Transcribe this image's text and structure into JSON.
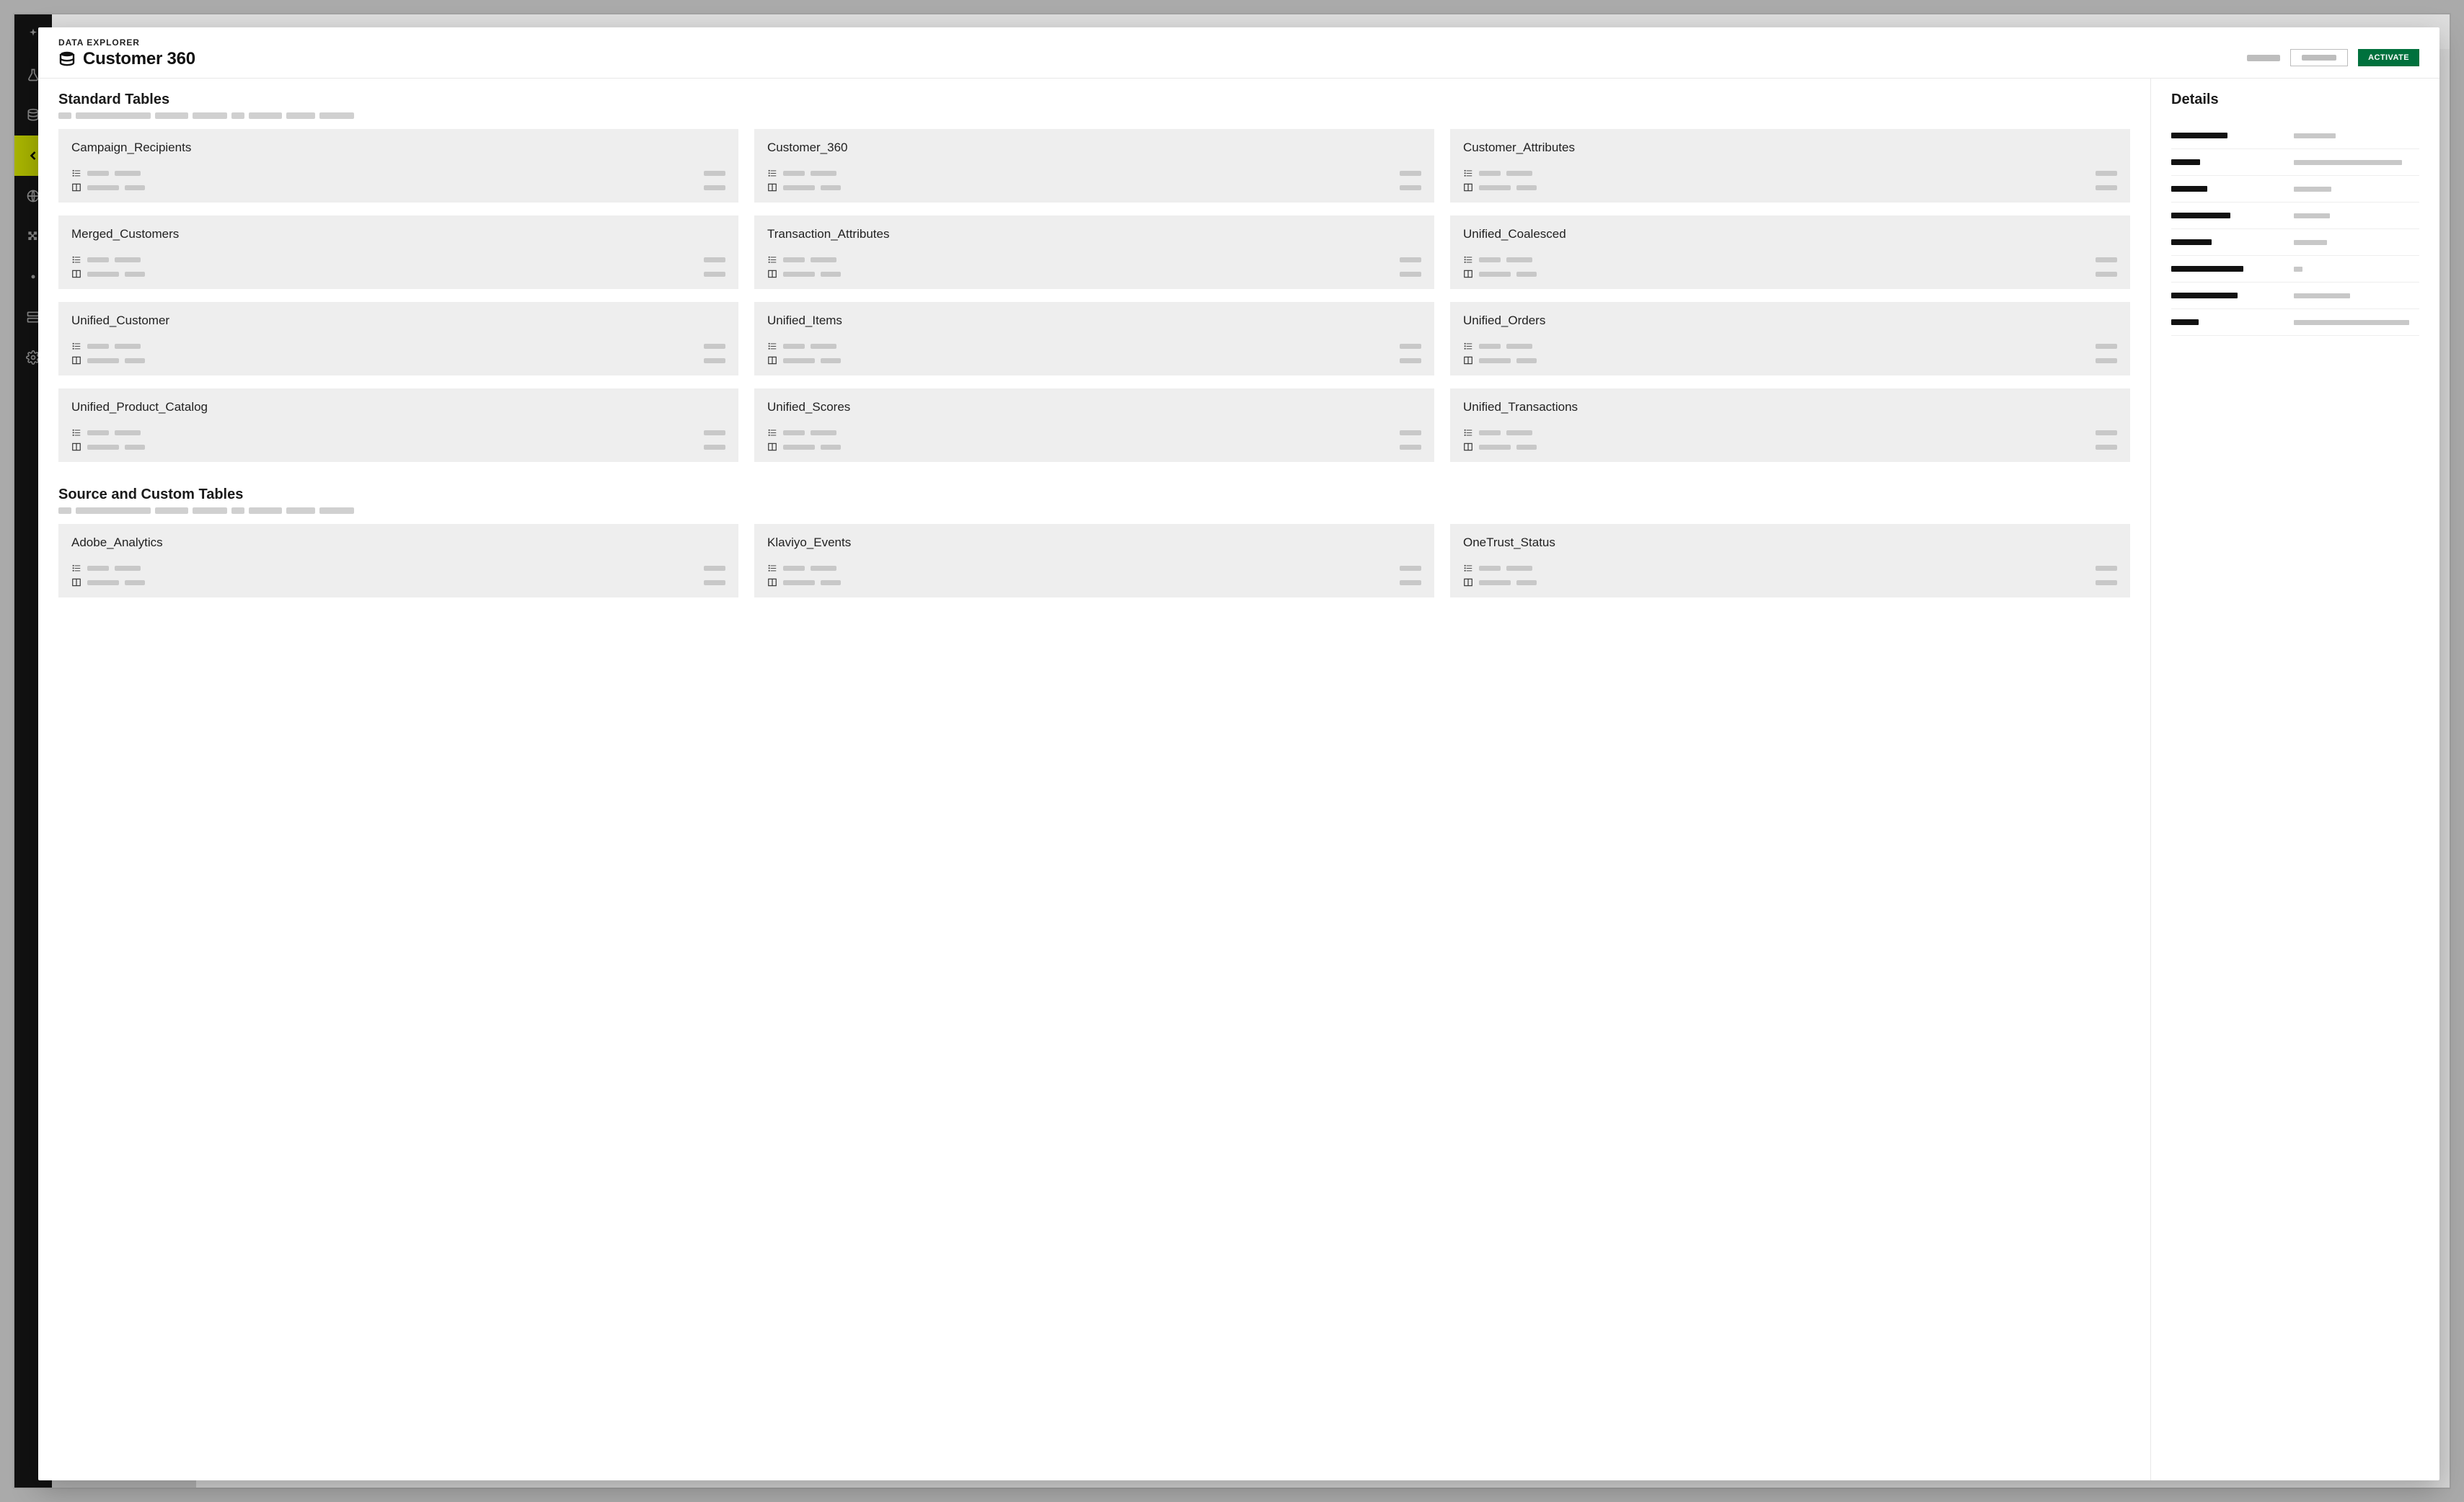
{
  "header": {
    "kicker": "DATA EXPLORER",
    "title": "Customer 360",
    "activate_label": "ACTIVATE"
  },
  "sidebar": {
    "items": [
      {
        "icon": "sparkle-icon"
      },
      {
        "icon": "flask-icon"
      },
      {
        "icon": "database-icon"
      },
      {
        "icon": "chevron-left-icon",
        "active": true
      },
      {
        "icon": "globe-icon"
      },
      {
        "icon": "puzzle-icon"
      },
      {
        "icon": "dot-icon"
      },
      {
        "icon": "server-icon"
      },
      {
        "icon": "gear-icon"
      }
    ]
  },
  "sections": [
    {
      "title": "Standard Tables",
      "cards": [
        {
          "name": "Campaign_Recipients"
        },
        {
          "name": "Customer_360"
        },
        {
          "name": "Customer_Attributes"
        },
        {
          "name": "Merged_Customers"
        },
        {
          "name": "Transaction_Attributes"
        },
        {
          "name": "Unified_Coalesced"
        },
        {
          "name": "Unified_Customer"
        },
        {
          "name": "Unified_Items"
        },
        {
          "name": "Unified_Orders"
        },
        {
          "name": "Unified_Product_Catalog"
        },
        {
          "name": "Unified_Scores"
        },
        {
          "name": "Unified_Transactions"
        }
      ]
    },
    {
      "title": "Source and Custom Tables",
      "cards": [
        {
          "name": "Adobe_Analytics"
        },
        {
          "name": "Klaviyo_Events"
        },
        {
          "name": "OneTrust_Status"
        }
      ]
    }
  ],
  "details": {
    "title": "Details",
    "rows": [
      {
        "kw": 78,
        "vw": 58
      },
      {
        "kw": 40,
        "vw": 150
      },
      {
        "kw": 50,
        "vw": 52
      },
      {
        "kw": 82,
        "vw": 50
      },
      {
        "kw": 56,
        "vw": 46
      },
      {
        "kw": 100,
        "vw": 12
      },
      {
        "kw": 92,
        "vw": 78
      },
      {
        "kw": 38,
        "vw": 160
      }
    ]
  }
}
